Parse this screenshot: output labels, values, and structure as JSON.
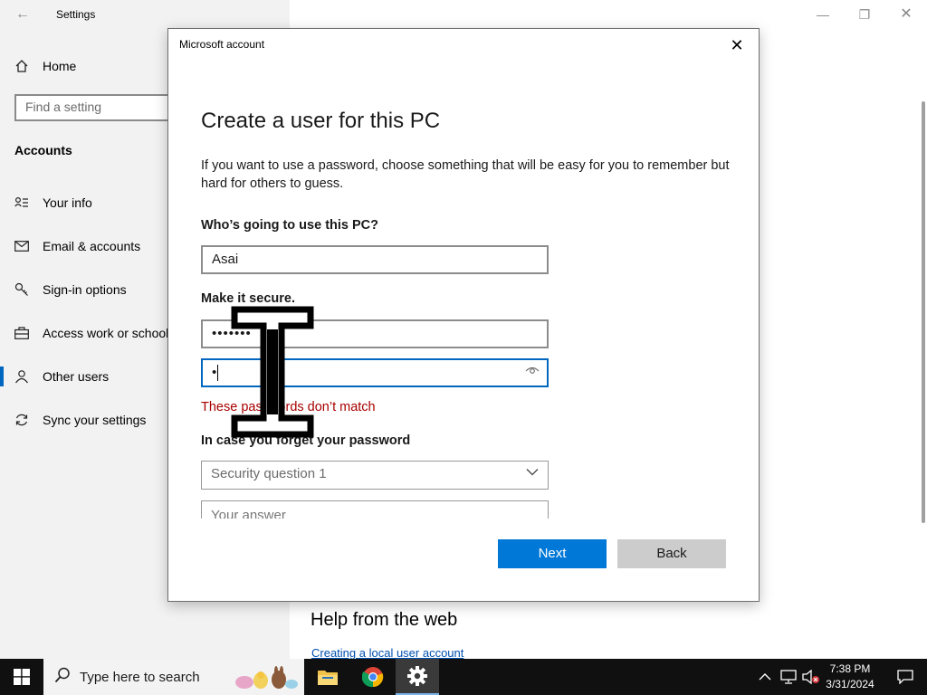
{
  "settings": {
    "title": "Settings",
    "back_glyph": "←",
    "home_label": "Home",
    "search_placeholder": "Find a setting",
    "section_title": "Accounts",
    "nav": [
      {
        "label": "Your info",
        "icon": "person-card-icon"
      },
      {
        "label": "Email & accounts",
        "icon": "mail-icon"
      },
      {
        "label": "Sign-in options",
        "icon": "key-icon"
      },
      {
        "label": "Access work or school",
        "icon": "briefcase-icon"
      },
      {
        "label": "Other users",
        "icon": "people-icon",
        "active": true
      },
      {
        "label": "Sync your settings",
        "icon": "sync-icon"
      }
    ],
    "help_title": "Help from the web",
    "help_link": "Creating a local user account"
  },
  "dialog": {
    "caption": "Microsoft account",
    "heading": "Create a user for this PC",
    "description": "If you want to use a password, choose something that will be easy for you to remember but hard for others to guess.",
    "who_label": "Who’s going to use this PC?",
    "username_value": "Asai",
    "secure_label": "Make it secure.",
    "password_value": "•••••••",
    "confirm_value": "•",
    "error_text": "These passwords don’t match",
    "forget_label": "In case you forget your password",
    "question1_value": "Security question 1",
    "answer_placeholder": "Your answer",
    "next_label": "Next",
    "back_label": "Back"
  },
  "taskbar": {
    "search_placeholder": "Type here to search",
    "time": "7:38 PM",
    "date": "3/31/2024",
    "apps": [
      "file-explorer-icon",
      "chrome-icon",
      "settings-gear-icon"
    ]
  },
  "colors": {
    "accent": "#0078d7",
    "error": "#a80000",
    "taskbar": "#101010"
  }
}
